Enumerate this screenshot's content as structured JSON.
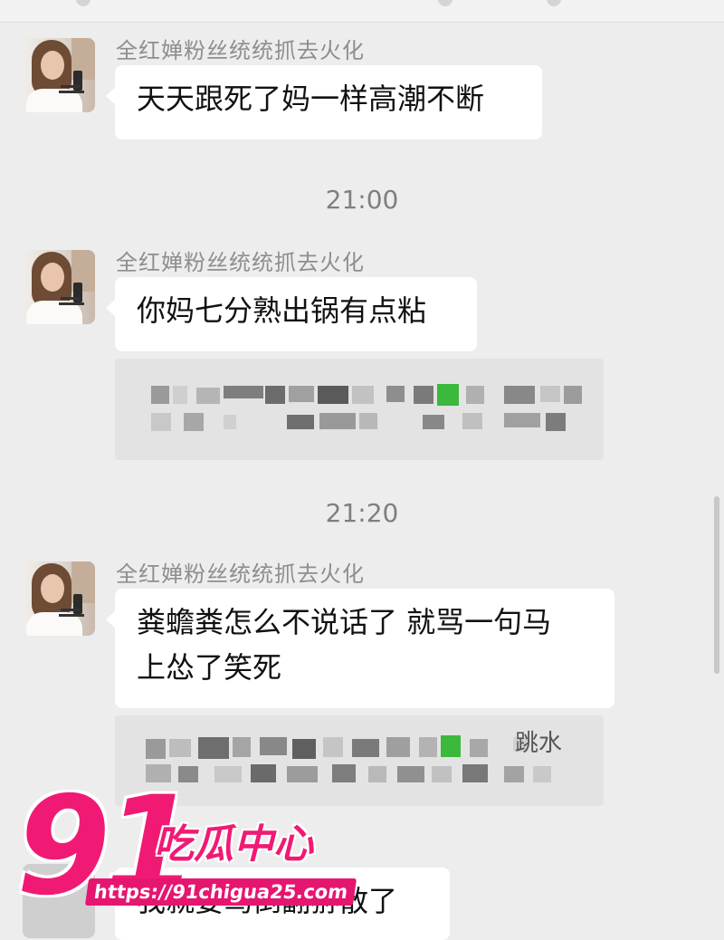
{
  "messages": [
    {
      "sender": "全红婵粉丝统统抓去火化",
      "text": "天天跟死了妈一样高潮不断"
    },
    {
      "time": "21:00"
    },
    {
      "sender": "全红婵粉丝统统抓去火化",
      "text": "你妈七分熟出锅有点粘"
    },
    {
      "time": "21:20"
    },
    {
      "sender": "全红婵粉丝统统抓去火化",
      "text_line1": "粪蟾粪怎么不说话了 就骂一句马",
      "text_line2": "上怂了笑死",
      "quote_visible_text": "跳水"
    },
    {
      "text": "我就要骂倒翻狲散了"
    }
  ],
  "watermark": {
    "number": "91",
    "brand": "吃瓜中心",
    "url": "https://91chigua25.com"
  },
  "icons": [
    "avatar",
    "mosaic-redaction"
  ],
  "colors": {
    "background": "#ededed",
    "bubble": "#ffffff",
    "watermark": "#f01a74"
  }
}
